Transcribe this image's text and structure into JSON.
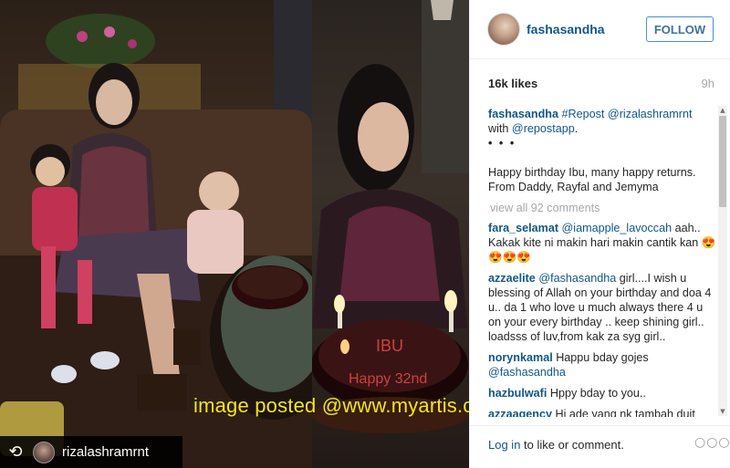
{
  "photo": {
    "repost_user": "rizalashramrnt",
    "repost_icon": "repost-icon",
    "watermark": "image posted @www.myartis.com"
  },
  "header": {
    "username": "fashasandha",
    "follow_label": "FOLLOW"
  },
  "meta": {
    "likes": "16k likes",
    "time_ago": "9h"
  },
  "caption": {
    "username": "fashasandha",
    "text_parts": [
      "#Repost",
      "@rizalashramrnt",
      "with",
      "@repostapp",
      "."
    ],
    "dots": "• • •",
    "body": "Happy birthday Ibu, many happy returns. From Daddy, Rayfal and Jemyma"
  },
  "view_all": "view all 92 comments",
  "comments": [
    {
      "user": "fara_selamat",
      "mention": "@iamapple_lavoccah",
      "text": " aah.. Kakak kite ni makin hari makin cantik kan 😍😍😍😍"
    },
    {
      "user": "azzaelite",
      "mention": "@fashasandha",
      "text": " girl....I wish u blessing of Allah on your birthday and doa 4 u.. da 1 who love u much always there 4 u on your every birthday .. keep shining girl.. loadsss of luv,from kak za syg girl.."
    },
    {
      "user": "norynkamal",
      "mention": "",
      "text": " Happu bday gojes ",
      "mention2": "@fashasandha"
    },
    {
      "user": "hazbulwafi",
      "mention": "",
      "text": " Hppy bday to you.."
    },
    {
      "user": "azzaagency",
      "mention": "",
      "text": " Hi ade yang nk tambah duit poket x wat part time jadi PELAKON"
    }
  ],
  "footer": {
    "login_link": "Log in",
    "login_rest": " to like or comment.",
    "more": "○○○"
  },
  "colors": {
    "link_blue": "#125688",
    "follow_border": "#4090db",
    "muted": "#a5a7aa",
    "watermark": "#f5e814"
  }
}
